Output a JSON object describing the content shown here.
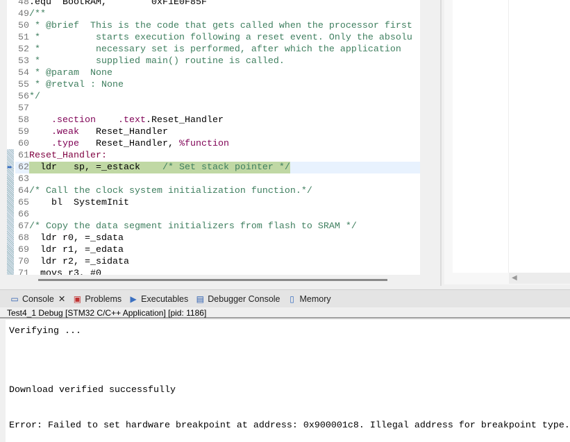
{
  "editor": {
    "current_line": 62,
    "lines": [
      {
        "n": "48",
        "segs": [
          [
            ".equ  BootRAM,        0xF1E0F85F",
            ""
          ]
        ]
      },
      {
        "n": "49",
        "segs": [
          [
            "/**",
            "cm"
          ]
        ]
      },
      {
        "n": "50",
        "segs": [
          [
            " * @brief  This is the code that gets called when the processor first",
            "cm"
          ]
        ]
      },
      {
        "n": "51",
        "segs": [
          [
            " *          starts execution following a reset event. Only the absolu",
            "cm"
          ]
        ]
      },
      {
        "n": "52",
        "segs": [
          [
            " *          necessary set is performed, after which the application",
            "cm"
          ]
        ]
      },
      {
        "n": "53",
        "segs": [
          [
            " *          supplied main() routine is called.",
            "cm"
          ]
        ]
      },
      {
        "n": "54",
        "segs": [
          [
            " * @param  None",
            "cm"
          ]
        ]
      },
      {
        "n": "55",
        "segs": [
          [
            " * @retval : None",
            "cm"
          ]
        ]
      },
      {
        "n": "56",
        "segs": [
          [
            "*/",
            "cm"
          ]
        ]
      },
      {
        "n": "57",
        "segs": []
      },
      {
        "n": "58",
        "segs": [
          [
            "    ",
            ""
          ],
          [
            ".section",
            "kw"
          ],
          [
            "    ",
            ""
          ],
          [
            ".text",
            "kw"
          ],
          [
            ".Reset_Handler",
            ""
          ]
        ]
      },
      {
        "n": "59",
        "segs": [
          [
            "    ",
            ""
          ],
          [
            ".weak",
            "kw"
          ],
          [
            "   Reset_Handler",
            ""
          ]
        ]
      },
      {
        "n": "60",
        "segs": [
          [
            "    ",
            ""
          ],
          [
            ".type",
            "kw"
          ],
          [
            "   Reset_Handler, ",
            ""
          ],
          [
            "%function",
            "kw"
          ]
        ]
      },
      {
        "n": "61",
        "segs": [
          [
            "Reset_Handler:",
            "lb"
          ]
        ]
      },
      {
        "n": "62",
        "segs": [
          [
            "  ldr   sp, =_estack    ",
            ""
          ],
          [
            "/* Set stack pointer */",
            "cm"
          ]
        ]
      },
      {
        "n": "63",
        "segs": []
      },
      {
        "n": "64",
        "segs": [
          [
            "/* Call the clock system initialization function.*/",
            "cm"
          ]
        ]
      },
      {
        "n": "65",
        "segs": [
          [
            "    bl  SystemInit",
            ""
          ]
        ]
      },
      {
        "n": "66",
        "segs": []
      },
      {
        "n": "67",
        "segs": [
          [
            "/* Copy the data segment initializers from flash to SRAM */",
            "cm"
          ]
        ]
      },
      {
        "n": "68",
        "segs": [
          [
            "  ldr r0, =_sdata",
            ""
          ]
        ]
      },
      {
        "n": "69",
        "segs": [
          [
            "  ldr r1, =_edata",
            ""
          ]
        ]
      },
      {
        "n": "70",
        "segs": [
          [
            "  ldr r2, =_sidata",
            ""
          ]
        ]
      },
      {
        "n": "71",
        "segs": [
          [
            "  movs r3, #0",
            ""
          ]
        ]
      }
    ]
  },
  "tabs": [
    {
      "label": "Console",
      "icon": "console-icon",
      "glyph": "▭",
      "color": "#2a5db0",
      "close": "✕"
    },
    {
      "label": "Problems",
      "icon": "problems-icon",
      "glyph": "▣",
      "color": "#c03030"
    },
    {
      "label": "Executables",
      "icon": "executables-icon",
      "glyph": "▶",
      "color": "#3a6fc0"
    },
    {
      "label": "Debugger Console",
      "icon": "debugger-console-icon",
      "glyph": "▤",
      "color": "#2a5db0"
    },
    {
      "label": "Memory",
      "icon": "memory-icon",
      "glyph": "▯",
      "color": "#3a6fc0"
    }
  ],
  "console": {
    "title": "Test4_1 Debug [STM32 C/C++ Application]  [pid: 1186]",
    "lines": [
      "Verifying ...",
      "",
      "",
      "",
      "",
      "Download verified successfully",
      "",
      "",
      "Error: Failed to set hardware breakpoint at address: 0x900001c8. Illegal address for breakpoint type."
    ]
  }
}
